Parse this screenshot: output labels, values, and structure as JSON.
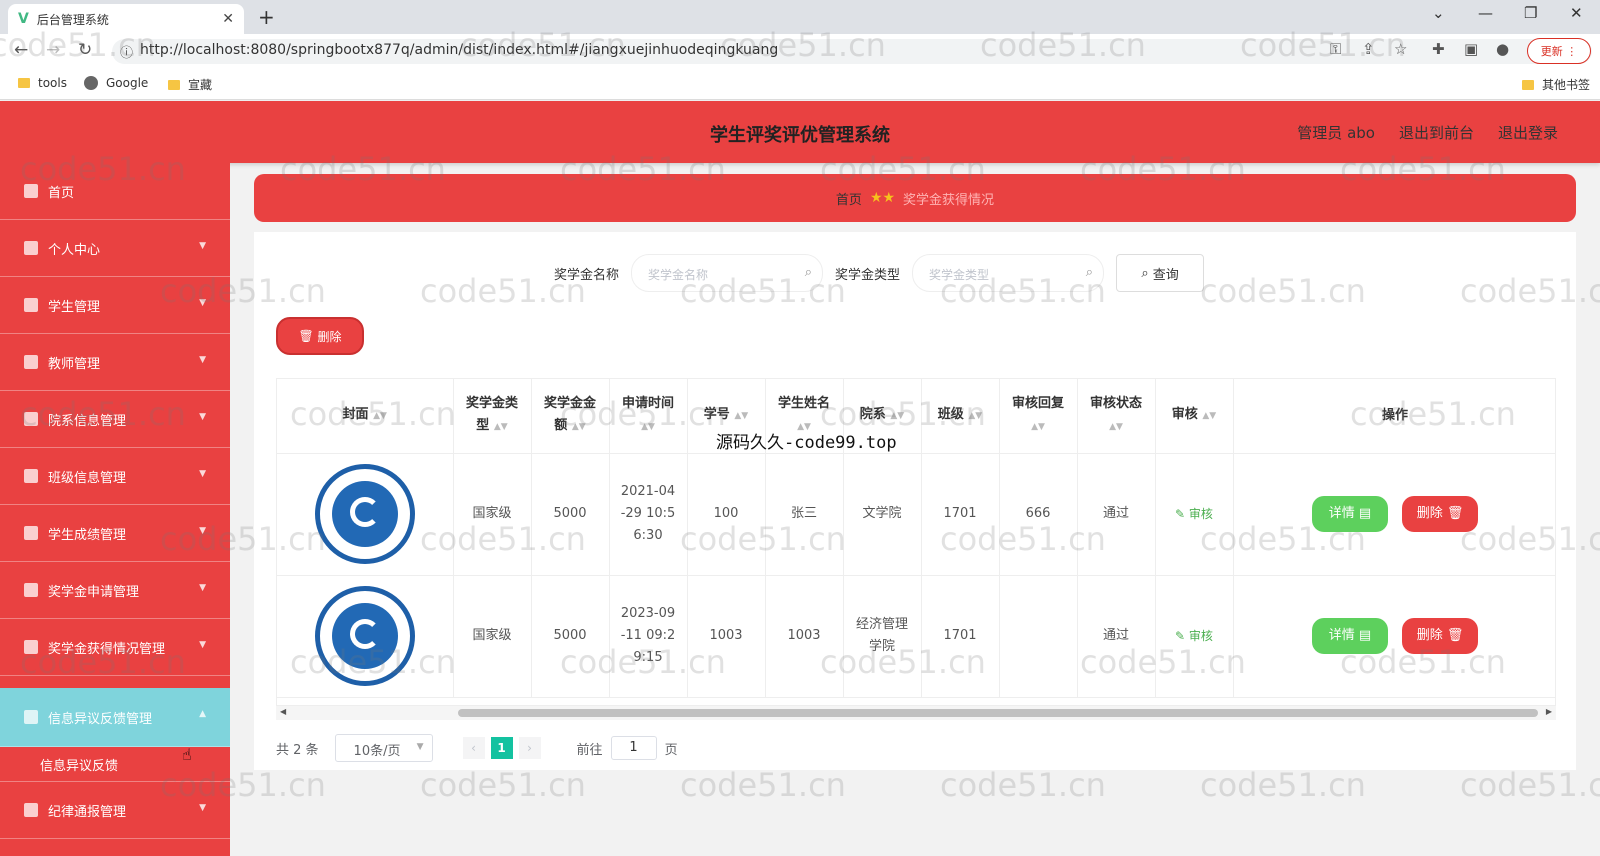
{
  "browser": {
    "tab_title": "后台管理系统",
    "favicon": "V",
    "url": "http://localhost:8080/springbootx877q/admin/dist/index.html#/jiangxuejinhuodeqingkuang",
    "update_label": "更新",
    "bookmarks": [
      "tools",
      "Google",
      "宣藏"
    ],
    "other_bookmarks": "其他书签"
  },
  "header": {
    "title": "学生评奖评优管理系统",
    "links": [
      "管理员 abo",
      "退出到前台",
      "退出登录"
    ]
  },
  "sidebar": {
    "items": [
      {
        "label": "首页"
      },
      {
        "label": "个人中心"
      },
      {
        "label": "学生管理"
      },
      {
        "label": "教师管理"
      },
      {
        "label": "院系信息管理"
      },
      {
        "label": "班级信息管理"
      },
      {
        "label": "学生成绩管理"
      },
      {
        "label": "奖学金申请管理"
      },
      {
        "label": "奖学金获得情况管理"
      },
      {
        "label": "信息异议反馈管理"
      },
      {
        "label": "纪律通报管理"
      }
    ],
    "active_index": 9,
    "submenu_label": "信息异议反馈"
  },
  "breadcrumb": {
    "home": "首页",
    "stars": "★★",
    "current": "奖学金获得情况"
  },
  "search": {
    "name_label": "奖学金名称",
    "name_placeholder": "奖学金名称",
    "type_label": "奖学金类型",
    "type_placeholder": "奖学金类型",
    "query_label": "查询"
  },
  "toolbar": {
    "delete_label": "删除"
  },
  "table": {
    "columns": [
      [
        "封面"
      ],
      [
        "奖学金类",
        "型"
      ],
      [
        "奖学金金",
        "额"
      ],
      [
        "申请时间",
        ""
      ],
      [
        "学号"
      ],
      [
        "学生姓名",
        ""
      ],
      [
        "院系"
      ],
      [
        "班级"
      ],
      [
        "审核回复",
        ""
      ],
      [
        "审核状态",
        ""
      ],
      [
        "审核"
      ],
      [
        "操作"
      ]
    ],
    "rows": [
      {
        "type": "国家级",
        "amount": "5000",
        "time_lines": [
          "2021-04",
          "-29 10:5",
          "6:30"
        ],
        "student_id": "100",
        "student_name": "张三",
        "dept_lines": [
          "文学院"
        ],
        "class": "1701",
        "reply": "666",
        "status": "通过",
        "audit_label": "审核",
        "detail_label": "详情",
        "delete_label": "删除"
      },
      {
        "type": "国家级",
        "amount": "5000",
        "time_lines": [
          "2023-09",
          "-11 09:2",
          "9:15"
        ],
        "student_id": "1003",
        "student_name": "1003",
        "dept_lines": [
          "经济管理",
          "学院"
        ],
        "class": "1701",
        "reply": "",
        "status": "通过",
        "audit_label": "审核",
        "detail_label": "详情",
        "delete_label": "删除"
      }
    ]
  },
  "pager": {
    "total": "共 2 条",
    "page_size": "10条/页",
    "current_page": "1",
    "goto_label": "前往",
    "goto_value": "1",
    "page_unit": "页"
  },
  "overlay": "源码久久-code99.top",
  "watermark": "code51.cn"
}
